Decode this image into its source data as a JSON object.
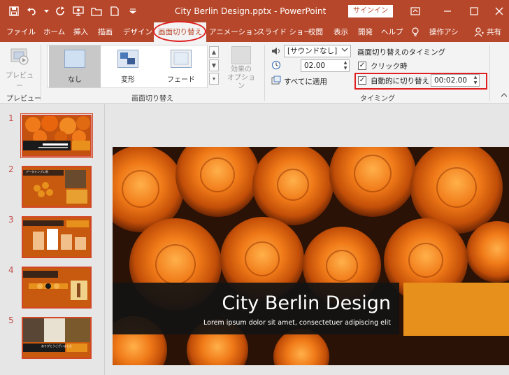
{
  "titlebar": {
    "doc_title": "City Berlin Design.pptx  -  PowerPoint",
    "signin_label": "サインイン",
    "qat_icons": [
      "save-icon",
      "undo-icon",
      "redo-icon",
      "present-icon",
      "open-icon",
      "new-icon",
      "customize-icon"
    ],
    "window_icons": [
      "ribbon-display-icon",
      "minimize-icon",
      "maximize-icon",
      "close-icon"
    ]
  },
  "tabs": [
    "ファイル",
    "ホーム",
    "挿入",
    "描画",
    "デザイン",
    "画面切り替え",
    "アニメーション",
    "スライド ショー",
    "校閲",
    "表示",
    "開発",
    "ヘルプ",
    "操作アシ",
    "共有"
  ],
  "ribbon": {
    "preview_label": "プレビュー",
    "preview_group_label": "プレビュー",
    "gallery_items": [
      "なし",
      "変形",
      "フェード"
    ],
    "transitions_group_label": "画面切り替え",
    "effect_options_label": "効果の\nオプション",
    "sound_value": "[サウンドなし]",
    "duration_value": "02.00",
    "apply_all_label": "すべてに適用",
    "timing_heading": "画面切り替えのタイミング",
    "on_click_label": "クリック時",
    "after_label": "自動的に切り替え",
    "after_value": "00:02.00",
    "timing_group_label": "タイミング"
  },
  "thumbnails": {
    "numbers": [
      "1",
      "2",
      "3",
      "4",
      "5"
    ],
    "slide2_title": "データテンプレ例",
    "slide5_caption": "ありがとうございました"
  },
  "slide": {
    "title": "City Berlin Design",
    "subtitle": "Lorem ipsum dolor sit amet, consectetuer adipiscing elit"
  },
  "colors": {
    "brand": "#b7472a",
    "accent_orange": "#e8901c",
    "highlight_red": "#e02020"
  }
}
